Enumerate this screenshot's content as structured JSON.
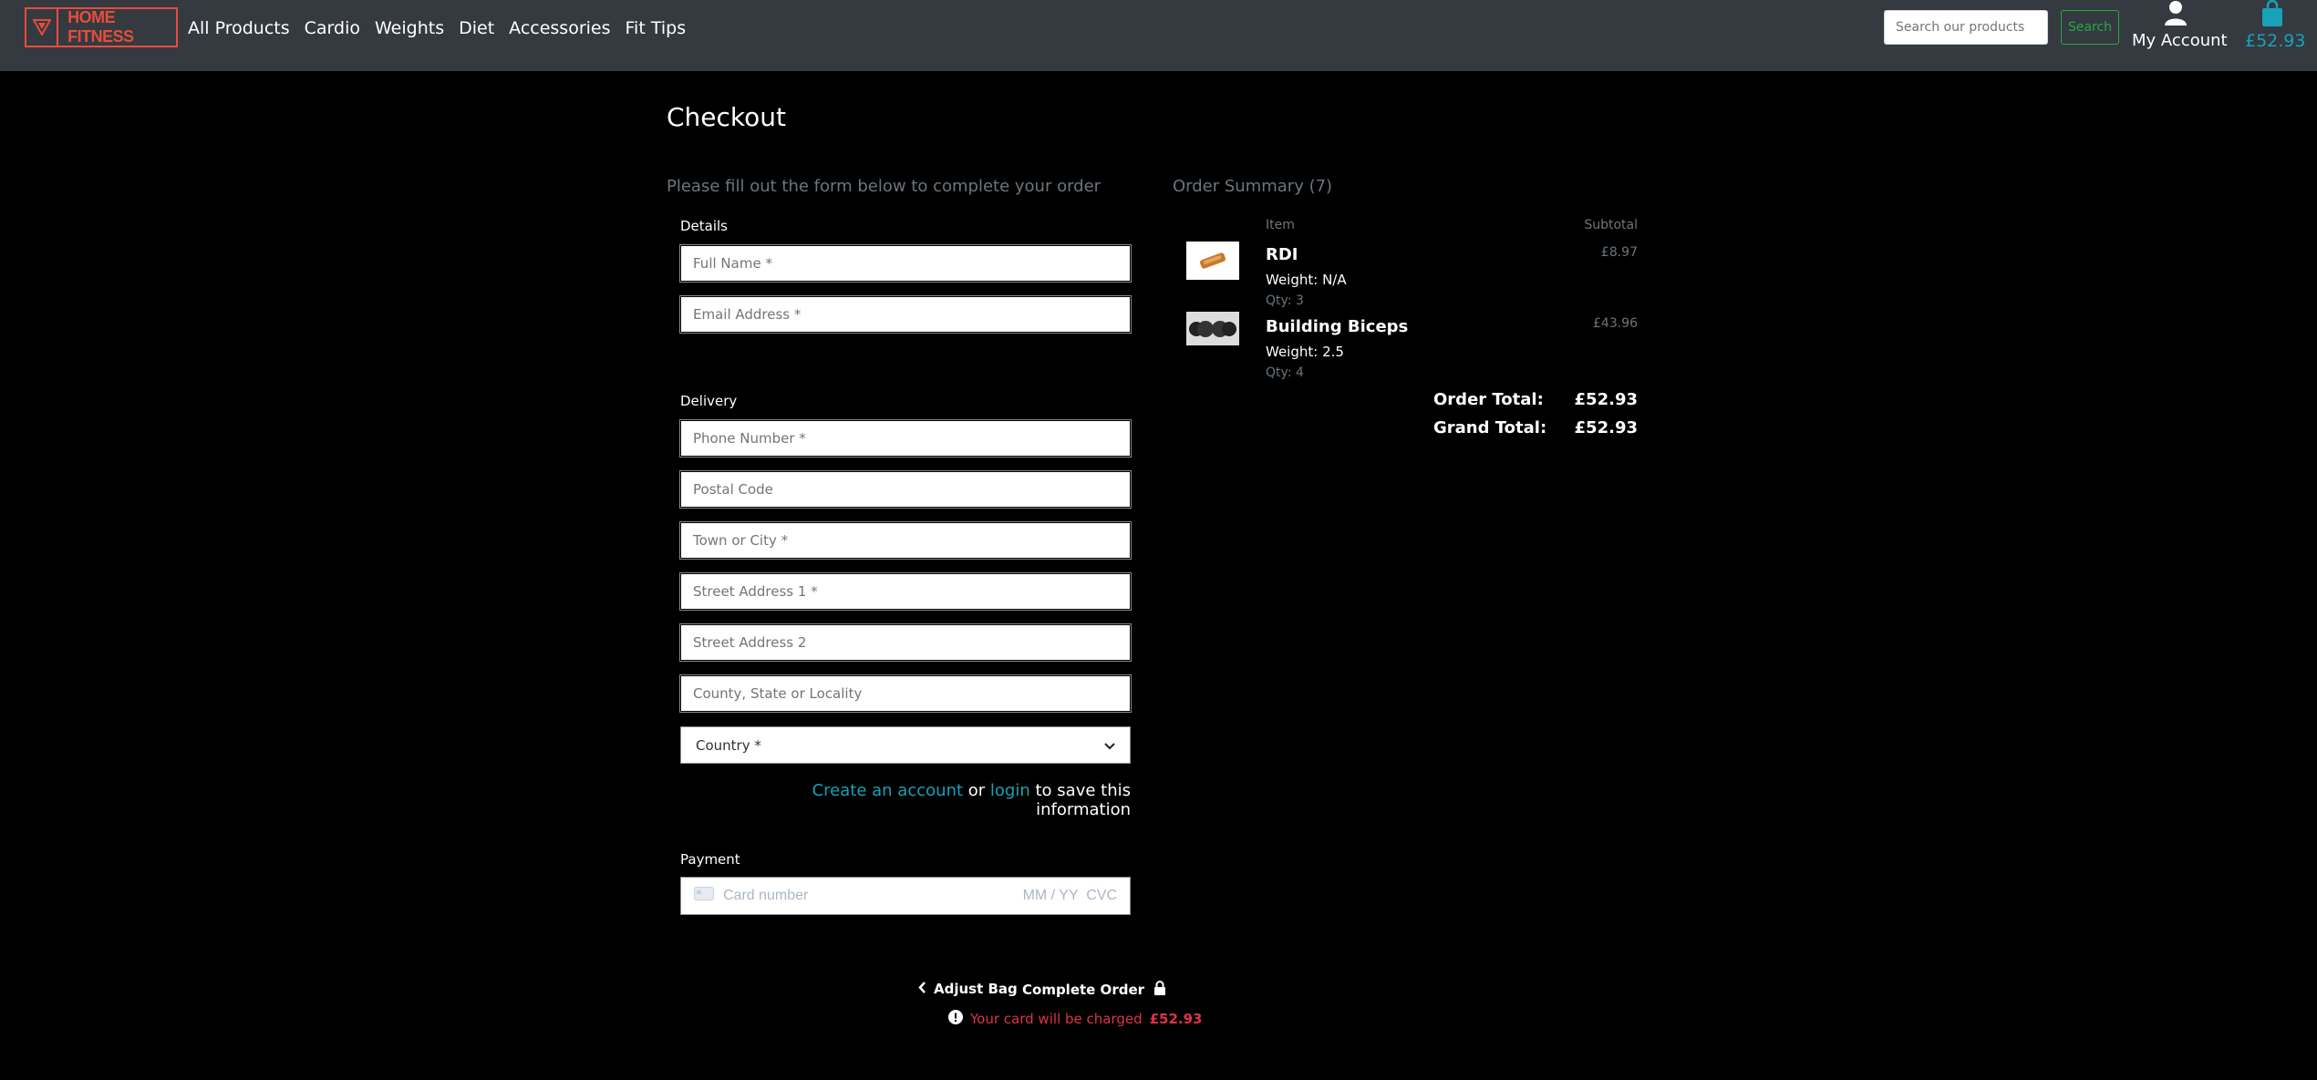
{
  "header": {
    "brand": "HOME FITNESS",
    "nav": [
      "All Products",
      "Cardio",
      "Weights",
      "Diet",
      "Accessories",
      "Fit Tips"
    ],
    "search_placeholder": "Search our products",
    "search_button": "Search",
    "account_label": "My Account",
    "bag_total": "£52.93",
    "colors": {
      "brand": "#e74c3c",
      "accent": "#17a2b8",
      "success": "#28a745",
      "bar": "#343a40"
    }
  },
  "checkout": {
    "title": "Checkout",
    "intro": "Please fill out the form below to complete your order",
    "details_label": "Details",
    "details_fields": [
      "Full Name *",
      "Email Address *"
    ],
    "delivery_label": "Delivery",
    "delivery_fields": [
      "Phone Number *",
      "Postal Code",
      "Town or City *",
      "Street Address 1 *",
      "Street Address 2",
      "County, State or Locality"
    ],
    "country_placeholder": "Country *",
    "save_info": {
      "create": "Create an account",
      "or": "or",
      "login": "login",
      "rest": "to save this information"
    },
    "payment_label": "Payment",
    "card": {
      "number_placeholder": "Card number",
      "expiry_cvc": "MM / YY  CVC"
    },
    "adjust_bag": "Adjust Bag",
    "complete_order": "Complete Order",
    "charge_text": "Your card will be charged",
    "charge_amount": "£52.93"
  },
  "summary": {
    "title": "Order Summary (7)",
    "col_item": "Item",
    "col_subtotal": "Subtotal",
    "items": [
      {
        "name": "RDI",
        "weight": "Weight: N/A",
        "qty": "Qty: 3",
        "subtotal": "£8.97"
      },
      {
        "name": "Building Biceps",
        "weight": "Weight: 2.5",
        "qty": "Qty: 4",
        "subtotal": "£43.96"
      }
    ],
    "order_total_label": "Order Total:",
    "order_total": "£52.93",
    "grand_total_label": "Grand Total:",
    "grand_total": "£52.93"
  }
}
